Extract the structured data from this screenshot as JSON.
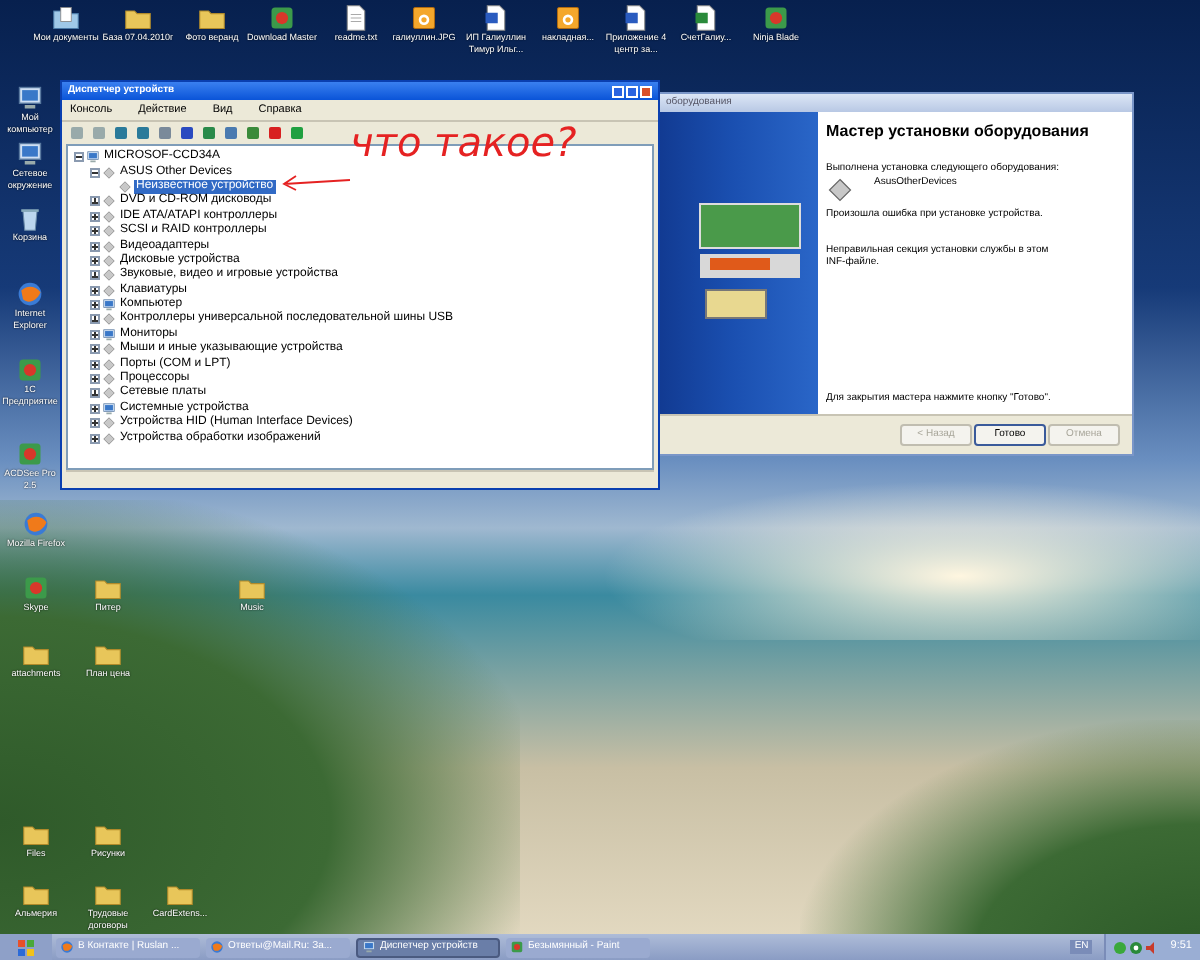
{
  "desktop_icons": [
    {
      "label": "Мои документы",
      "kind": "folder-doc"
    },
    {
      "label": "База 07.04.2010г",
      "kind": "folder"
    },
    {
      "label": "Фото веранд",
      "kind": "folder"
    },
    {
      "label": "Download Master",
      "kind": "app"
    },
    {
      "label": "readme.txt",
      "kind": "doc"
    },
    {
      "label": "галиуллин.JPG",
      "kind": "image"
    },
    {
      "label": "ИП Галиуллин Тимур Ильг...",
      "kind": "word"
    },
    {
      "label": "накладная...",
      "kind": "image"
    },
    {
      "label": "Приложение 4 центр за...",
      "kind": "word"
    },
    {
      "label": "СчетГалиу...",
      "kind": "excel"
    },
    {
      "label": "Ninja Blade",
      "kind": "app"
    },
    {
      "label": "Мой компьютер",
      "kind": "computer"
    },
    {
      "label": "Сетевое окружение",
      "kind": "computer"
    },
    {
      "label": "Корзина",
      "kind": "trash"
    },
    {
      "label": "Internet Explorer",
      "kind": "browser"
    },
    {
      "label": "1С Предприятие",
      "kind": "app"
    },
    {
      "label": "ACDSee Pro 2.5",
      "kind": "app"
    },
    {
      "label": "Mozilla Firefox",
      "kind": "browser"
    },
    {
      "label": "Skype",
      "kind": "app"
    },
    {
      "label": "Питер",
      "kind": "folder"
    },
    {
      "label": "Music",
      "kind": "folder"
    },
    {
      "label": "attachments",
      "kind": "folder"
    },
    {
      "label": "План цена",
      "kind": "folder"
    },
    {
      "label": "Files",
      "kind": "folder"
    },
    {
      "label": "Рисунки",
      "kind": "folder"
    },
    {
      "label": "Альмерия",
      "kind": "folder"
    },
    {
      "label": "Трудовые договоры",
      "kind": "folder"
    },
    {
      "label": "CardExtens...",
      "kind": "folder"
    }
  ],
  "device_manager": {
    "title": "Диспетчер устройств",
    "menu": [
      "Консоль",
      "Действие",
      "Вид",
      "Справка"
    ],
    "tree": [
      {
        "label": "MICROSOF-CCD34A",
        "kind": "computer",
        "expanded": true,
        "selected": false,
        "children": [
          {
            "label": "ASUS Other Devices",
            "kind": "device",
            "expanded": true,
            "selected": false,
            "children": [
              {
                "label": "Неизвестное устройство",
                "kind": "device",
                "selected": true
              }
            ]
          },
          {
            "label": "DVD и CD-ROM дисководы",
            "kind": "device",
            "expanded": false,
            "selected": false
          },
          {
            "label": "IDE ATA/ATAPI контроллеры",
            "kind": "device",
            "expanded": false,
            "selected": false
          },
          {
            "label": "SCSI и RAID контроллеры",
            "kind": "device",
            "expanded": false,
            "selected": false
          },
          {
            "label": "Видеоадаптеры",
            "kind": "device",
            "expanded": false,
            "selected": false
          },
          {
            "label": "Дисковые устройства",
            "kind": "device",
            "expanded": false,
            "selected": false
          },
          {
            "label": "Звуковые, видео и игровые устройства",
            "kind": "device",
            "expanded": false,
            "selected": false
          },
          {
            "label": "Клавиатуры",
            "kind": "device",
            "expanded": false,
            "selected": false
          },
          {
            "label": "Компьютер",
            "kind": "computer",
            "expanded": false,
            "selected": false
          },
          {
            "label": "Контроллеры универсальной последовательной шины USB",
            "kind": "device",
            "expanded": false,
            "selected": false
          },
          {
            "label": "Мониторы",
            "kind": "computer",
            "expanded": false,
            "selected": false
          },
          {
            "label": "Мыши и иные указывающие устройства",
            "kind": "device",
            "expanded": false,
            "selected": false
          },
          {
            "label": "Порты (COM и LPT)",
            "kind": "device",
            "expanded": false,
            "selected": false
          },
          {
            "label": "Процессоры",
            "kind": "device",
            "expanded": false,
            "selected": false
          },
          {
            "label": "Сетевые платы",
            "kind": "device",
            "expanded": false,
            "selected": false
          },
          {
            "label": "Системные устройства",
            "kind": "computer",
            "expanded": false,
            "selected": false
          },
          {
            "label": "Устройства HID (Human Interface Devices)",
            "kind": "device",
            "expanded": false,
            "selected": false
          },
          {
            "label": "Устройства обработки изображений",
            "kind": "device",
            "expanded": false,
            "selected": false
          }
        ]
      }
    ]
  },
  "annotation": {
    "text": "что такое?"
  },
  "wizard": {
    "title": "оборудования",
    "heading": "Мастер установки оборудования",
    "intro": "Выполнена установка следующего оборудования:",
    "device": "AsusOtherDevices",
    "error": "Произошла ошибка при установке устройства.",
    "detail": "Неправильная секция установки службы в этом INF-файле.",
    "footer": "Для закрытия мастера нажмите кнопку \"Готово\".",
    "buttons": [
      {
        "label": "< Назад",
        "disabled": true
      },
      {
        "label": "Готово",
        "disabled": false
      },
      {
        "label": "Отмена",
        "disabled": true
      }
    ]
  },
  "taskbar": {
    "tasks": [
      {
        "label": "В Контакте | Ruslan ...",
        "kind": "browser",
        "selected": false
      },
      {
        "label": "Ответы@Mail.Ru: За...",
        "kind": "browser",
        "selected": false
      },
      {
        "label": "Диспетчер устройств",
        "kind": "computer",
        "selected": true
      },
      {
        "label": "Безымянный - Paint",
        "kind": "app",
        "selected": false
      }
    ],
    "language": "EN",
    "clock": "9:51"
  }
}
